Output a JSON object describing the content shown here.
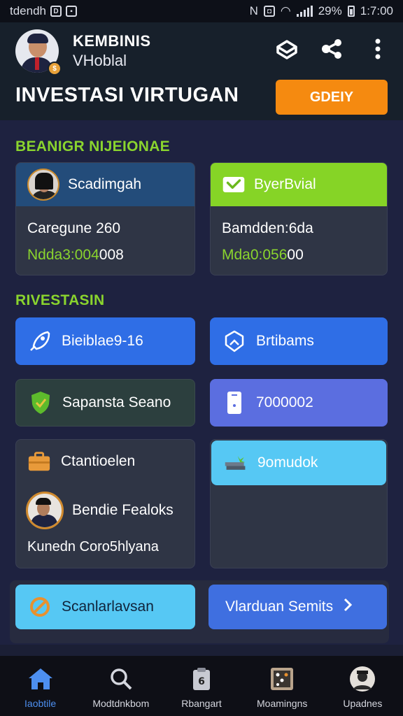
{
  "status_bar": {
    "carrier": "tdendh",
    "battery": "29%",
    "time": "1:7:00"
  },
  "header": {
    "user_name": "KEMBINIS",
    "user_subtitle": "VHoblal",
    "title": "INVESTASI  VIRTUGAN",
    "action_button": "GDEIY"
  },
  "section1": {
    "title": "BEANIGR NIJEIONAE",
    "card_left": {
      "name": "Scadimgah",
      "line1": "Caregune 260",
      "line2_green": "Ndda3:004",
      "line2_white": "008"
    },
    "card_right": {
      "name": "ByerBvial",
      "line1": "Bamdden:6da",
      "line2_green": "Mda0:056",
      "line2_white": "00"
    }
  },
  "section2": {
    "title": "RIVESTASIN",
    "tiles": {
      "t1": "Bieiblae9-16",
      "t2": "Brtibams",
      "t3": "Sapansta Seano",
      "t4": "7000002",
      "t5": "Ctantioelen",
      "t6": "9omudok",
      "t7": "Bendie Fealoks",
      "t8": "Kunedn Coro5hlyana"
    },
    "btn_left": "Scanlarlavsan",
    "btn_right": "Vlarduan Semits"
  },
  "nav": {
    "items": [
      {
        "label": "Iaobtile",
        "icon": "home-icon"
      },
      {
        "label": "Modtdnkbom",
        "icon": "search-icon"
      },
      {
        "label": "Rbangart",
        "icon": "clipboard-icon"
      },
      {
        "label": "Moamingns",
        "icon": "grid-board-icon"
      },
      {
        "label": "Upadnes",
        "icon": "profile-icon"
      }
    ]
  },
  "colors": {
    "accent_green": "#8ad42e",
    "accent_orange": "#f58a10",
    "blue_tile": "#2f6ee6",
    "nav_active": "#4d8ff0"
  }
}
